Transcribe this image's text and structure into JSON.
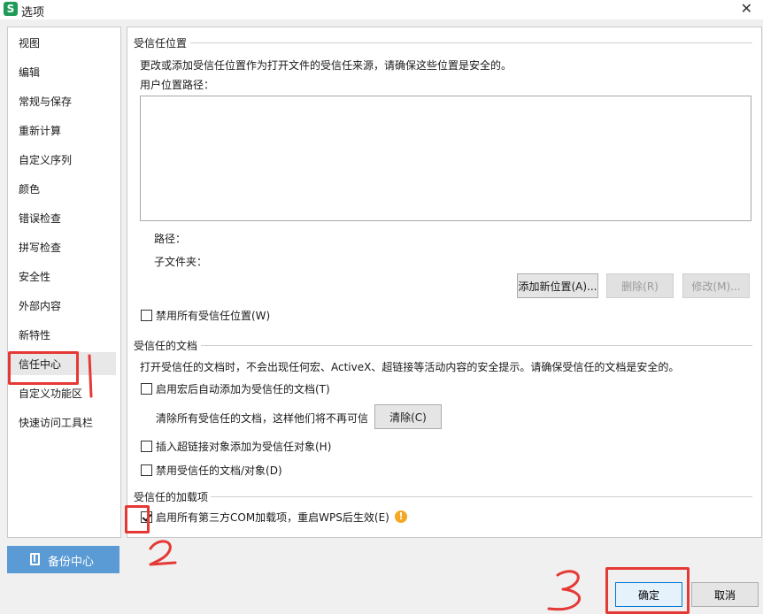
{
  "window": {
    "title": "选项",
    "app_icon_letter": "S",
    "close_glyph": "✕"
  },
  "sidebar": {
    "items": [
      {
        "label": "视图"
      },
      {
        "label": "编辑"
      },
      {
        "label": "常规与保存"
      },
      {
        "label": "重新计算"
      },
      {
        "label": "自定义序列"
      },
      {
        "label": "颜色"
      },
      {
        "label": "错误检查"
      },
      {
        "label": "拼写检查"
      },
      {
        "label": "安全性"
      },
      {
        "label": "外部内容"
      },
      {
        "label": "新特性"
      },
      {
        "label": "信任中心",
        "selected": true
      },
      {
        "label": "自定义功能区"
      },
      {
        "label": "快速访问工具栏"
      }
    ],
    "backup_button": "备份中心"
  },
  "trusted_locations": {
    "title": "受信任位置",
    "description": "更改或添加受信任位置作为打开文件的受信任来源，请确保这些位置是安全的。",
    "user_path_label": "用户位置路径：",
    "path_label": "路径：",
    "subfolder_label": "子文件夹：",
    "add_button": "添加新位置(A)...",
    "delete_button": "删除(R)",
    "modify_button": "修改(M)...",
    "disable_all_label": "禁用所有受信任位置(W)",
    "disable_all_checked": false
  },
  "trusted_documents": {
    "title": "受信任的文档",
    "description": "打开受信任的文档时，不会出现任何宏、ActiveX、超链接等活动内容的安全提示。请确保受信任的文档是安全的。",
    "auto_add_label": "启用宏后自动添加为受信任的文档(T)",
    "auto_add_checked": false,
    "clear_text": "清除所有受信任的文档，这样他们将不再可信",
    "clear_button": "清除(C)",
    "hyperlink_label": "插入超链接对象添加为受信任对象(H)",
    "hyperlink_checked": false,
    "disable_label": "禁用受信任的文档/对象(D)",
    "disable_checked": false
  },
  "trusted_addins": {
    "title": "受信任的加载项",
    "com_label": "启用所有第三方COM加载项，重启WPS后生效(E)",
    "com_checked": true,
    "warning_glyph": "!"
  },
  "footer": {
    "ok_button": "确定",
    "cancel_button": "取消"
  },
  "annotations": {
    "ink_numbers": [
      "1",
      "2",
      "3"
    ],
    "ink_color": "#e53935"
  },
  "colors": {
    "backup_button": "#5b9bd5",
    "warning": "#f5a623",
    "app_icon": "#1e9b57"
  }
}
